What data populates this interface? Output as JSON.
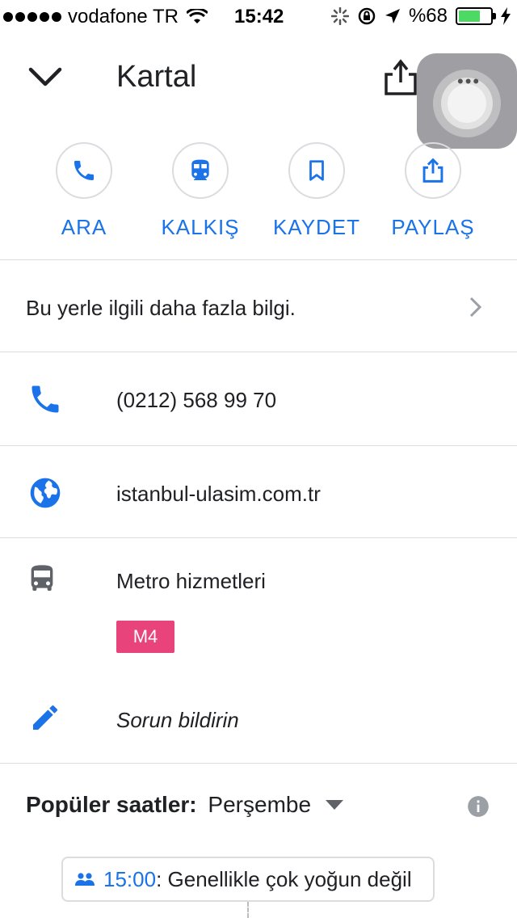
{
  "status_bar": {
    "carrier": "vodafone TR",
    "time": "15:42",
    "battery": "%68",
    "battery_level": 0.68
  },
  "header": {
    "title": "Kartal",
    "collapse_icon": "chevron-down-icon",
    "share_icon": "share-icon"
  },
  "actions": [
    {
      "label": "ARA",
      "icon": "phone-icon"
    },
    {
      "label": "KALKIŞ",
      "icon": "train-icon"
    },
    {
      "label": "KAYDET",
      "icon": "bookmark-icon"
    },
    {
      "label": "PAYLAŞ",
      "icon": "share-icon"
    }
  ],
  "more_info": {
    "label": "Bu yerle ilgili daha fazla bilgi."
  },
  "details": {
    "phone": "(0212) 568 99 70",
    "website": "istanbul-ulasim.com.tr",
    "transit_label": "Metro hizmetleri",
    "transit_line": "M4",
    "report": "Sorun bildirin"
  },
  "colors": {
    "accent": "#1a73e8",
    "line_m4": "#e8437a",
    "divider": "#dadce0"
  },
  "popular_times": {
    "label": "Popüler saatler:",
    "day": "Perşembe",
    "chip_time": "15:00",
    "chip_text": ": Genellikle çok yoğun değil"
  }
}
